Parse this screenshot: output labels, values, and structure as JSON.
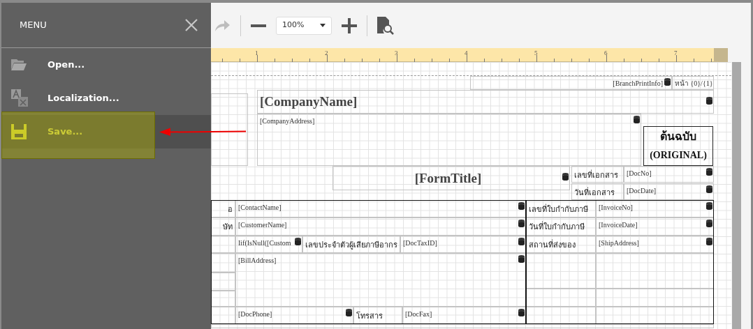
{
  "menu": {
    "title": "MENU",
    "items": [
      {
        "label": "Open...",
        "selected": false
      },
      {
        "label": "Localization...",
        "selected": false
      },
      {
        "label": "Save...",
        "selected": true
      }
    ]
  },
  "toolbar": {
    "zoom": "100%"
  },
  "ruler": {
    "labels": [
      "1",
      "2",
      "3",
      "4",
      "5",
      "6",
      "7"
    ]
  },
  "canvas": {
    "controls": [
      {
        "kind": "field",
        "text": "[BranchPrintInfo]",
        "bound": true
      },
      {
        "kind": "field",
        "text": "หน้า {0}/{1}",
        "bound": false
      },
      {
        "kind": "heading",
        "text": "[CompanyName]",
        "bound": true
      },
      {
        "kind": "field",
        "text": "[CompanyAddress]",
        "bound": true
      },
      {
        "kind": "stamp",
        "lines": [
          "ต้นฉบับ",
          "(ORIGINAL)"
        ],
        "bound": false
      },
      {
        "kind": "heading",
        "text": "[FormTitle]",
        "bound": true
      },
      {
        "kind": "label",
        "text": "เลขที่เอกสาร",
        "bound": false
      },
      {
        "kind": "field",
        "text": "[DocNo]",
        "bound": true
      },
      {
        "kind": "label",
        "text": "วันที่เอกสาร",
        "bound": false
      },
      {
        "kind": "field",
        "text": "[DocDate]",
        "bound": true
      },
      {
        "kind": "label",
        "text": "อ",
        "bound": false
      },
      {
        "kind": "field",
        "text": "[ContactName]",
        "bound": true
      },
      {
        "kind": "label",
        "text": "ษัท",
        "bound": false
      },
      {
        "kind": "field",
        "text": "[CustomerName]",
        "bound": true
      },
      {
        "kind": "field",
        "text": "Iif(IsNull([Custom",
        "bound": true
      },
      {
        "kind": "label",
        "text": "เลขประจำตัวผู้เสียภาษีอากร",
        "bound": false
      },
      {
        "kind": "field",
        "text": "[DocTaxID]",
        "bound": true
      },
      {
        "kind": "field",
        "text": "[BillAddress]",
        "bound": true
      },
      {
        "kind": "field",
        "text": "[DocPhone]",
        "bound": true
      },
      {
        "kind": "label",
        "text": "โทรสาร",
        "bound": false
      },
      {
        "kind": "field",
        "text": "[DocFax]",
        "bound": true
      },
      {
        "kind": "label",
        "text": "เลขที่ใบกำกับภาษี",
        "bound": false
      },
      {
        "kind": "field",
        "text": "[InvoiceNo]",
        "bound": true
      },
      {
        "kind": "label",
        "text": "วันที่ใบกำกับภาษี",
        "bound": false
      },
      {
        "kind": "field",
        "text": "[InvoiceDate]",
        "bound": true
      },
      {
        "kind": "label",
        "text": "สถานที่ส่งของ",
        "bound": false
      },
      {
        "kind": "field",
        "text": "[ShipAddress]",
        "bound": true
      }
    ]
  }
}
